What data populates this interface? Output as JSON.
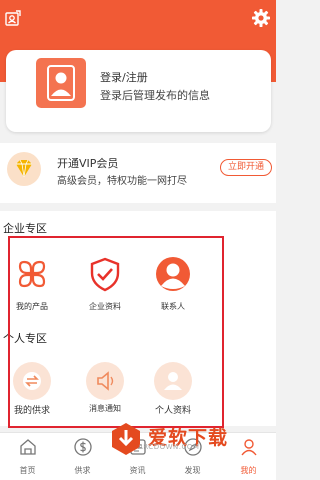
{
  "header": {
    "bg_color": "#f15a35",
    "left_icon": "profile-card-icon",
    "right_icon": "gear-icon"
  },
  "login": {
    "title": "登录/注册",
    "subtitle": "登录后管理发布的信息",
    "avatar_icon": "avatar-icon"
  },
  "vip": {
    "title": "开通VIP会员",
    "subtitle": "高级会员，特权功能一网打尽",
    "button": "立即开通",
    "icon": "diamond-icon"
  },
  "enterprise": {
    "title": "企业专区",
    "items": [
      {
        "label": "我的产品",
        "icon": "products-icon"
      },
      {
        "label": "企业资料",
        "icon": "shield-check-icon"
      },
      {
        "label": "联系人",
        "icon": "contact-icon"
      }
    ]
  },
  "personal": {
    "title": "个人专区",
    "items": [
      {
        "label": "我的供求",
        "icon": "exchange-icon"
      },
      {
        "label": "消息通知",
        "icon": "speaker-icon"
      },
      {
        "label": "个人资料",
        "icon": "person-icon"
      }
    ]
  },
  "watermark": {
    "text": "爱软下载",
    "url": "ARCDOWN.COM"
  },
  "tabbar": {
    "items": [
      {
        "label": "首页",
        "icon": "home-icon"
      },
      {
        "label": "供求",
        "icon": "dollar-icon"
      },
      {
        "label": "资讯",
        "icon": "news-icon"
      },
      {
        "label": "发现",
        "icon": "discover-icon"
      },
      {
        "label": "我的",
        "icon": "user-icon"
      }
    ],
    "active_index": 4
  },
  "colors": {
    "accent": "#f15a35",
    "frame": "#e0242f"
  }
}
